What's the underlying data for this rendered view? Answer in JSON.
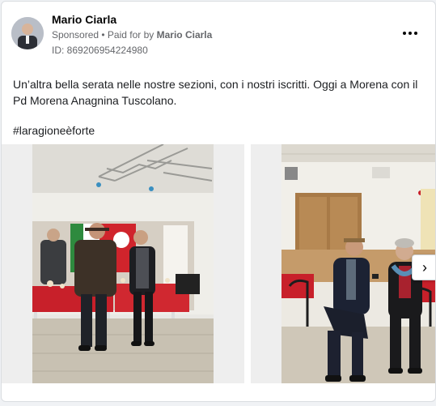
{
  "post": {
    "author": "Mario Ciarla",
    "sponsored": "Sponsored",
    "separator": " • ",
    "paid_for_prefix": "Paid for by ",
    "paid_for_name": "Mario Ciarla",
    "ad_id": "ID: 869206954224980",
    "text": "Un’altra bella serata nelle nostre sezioni, con i nostri iscritti. Oggi a Morena con il Pd Morena Anagnina Tuscolano.",
    "hashtag": "#laragioneèforte"
  },
  "icons": {
    "more": "more-options-icon",
    "next": "chevron-right-icon",
    "next_glyph": "›"
  },
  "colors": {
    "accent_red": "#c8202a",
    "text_secondary": "#65676b",
    "card_border": "#dadde1"
  }
}
